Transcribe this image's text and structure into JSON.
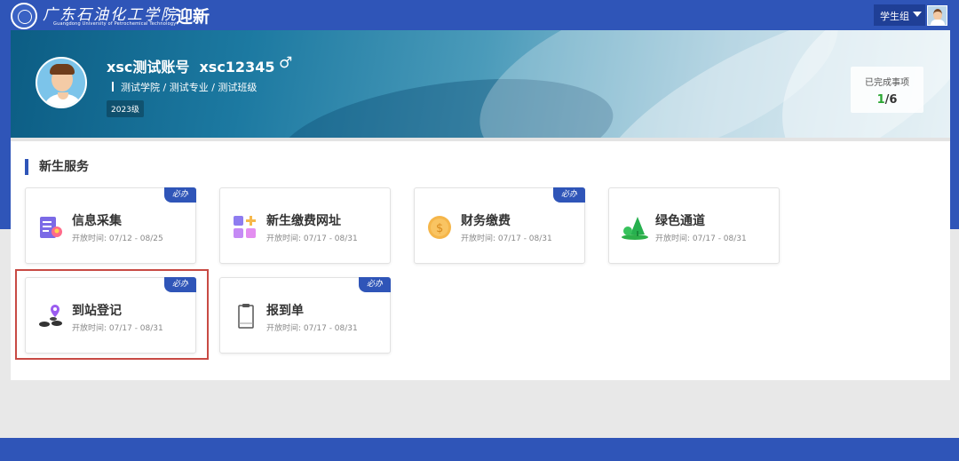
{
  "header": {
    "school_name_cn": "广东石油化工学院",
    "school_name_en": "Guangdong University of Petrochemical Technology",
    "app_title": "迎新",
    "role_select": "学生组"
  },
  "profile": {
    "name": "xsc测试账号  xsc12345",
    "gender_symbol": "♂",
    "department": "测试学院 / 测试专业 / 测试班级",
    "grade": "2023级",
    "completed_label": "已完成事项",
    "completed_done": "1",
    "completed_total": "/6"
  },
  "section": {
    "title": "新生服务"
  },
  "services": [
    {
      "title": "信息采集",
      "time": "开放时间: 07/12 - 08/25",
      "required": true,
      "badge": "必办"
    },
    {
      "title": "新生缴费网址",
      "time": "开放时间: 07/17 - 08/31",
      "required": false,
      "badge": ""
    },
    {
      "title": "财务缴费",
      "time": "开放时间: 07/17 - 08/31",
      "required": true,
      "badge": "必办"
    },
    {
      "title": "绿色通道",
      "time": "开放时间: 07/17 - 08/31",
      "required": false,
      "badge": ""
    },
    {
      "title": "到站登记",
      "time": "开放时间: 07/17 - 08/31",
      "required": true,
      "badge": "必办"
    },
    {
      "title": "报到单",
      "time": "开放时间: 07/17 - 08/31",
      "required": true,
      "badge": "必办"
    }
  ],
  "colors": {
    "brand_blue": "#2f55b8",
    "highlight_red": "#c84a44",
    "done_green": "#2aa632"
  }
}
